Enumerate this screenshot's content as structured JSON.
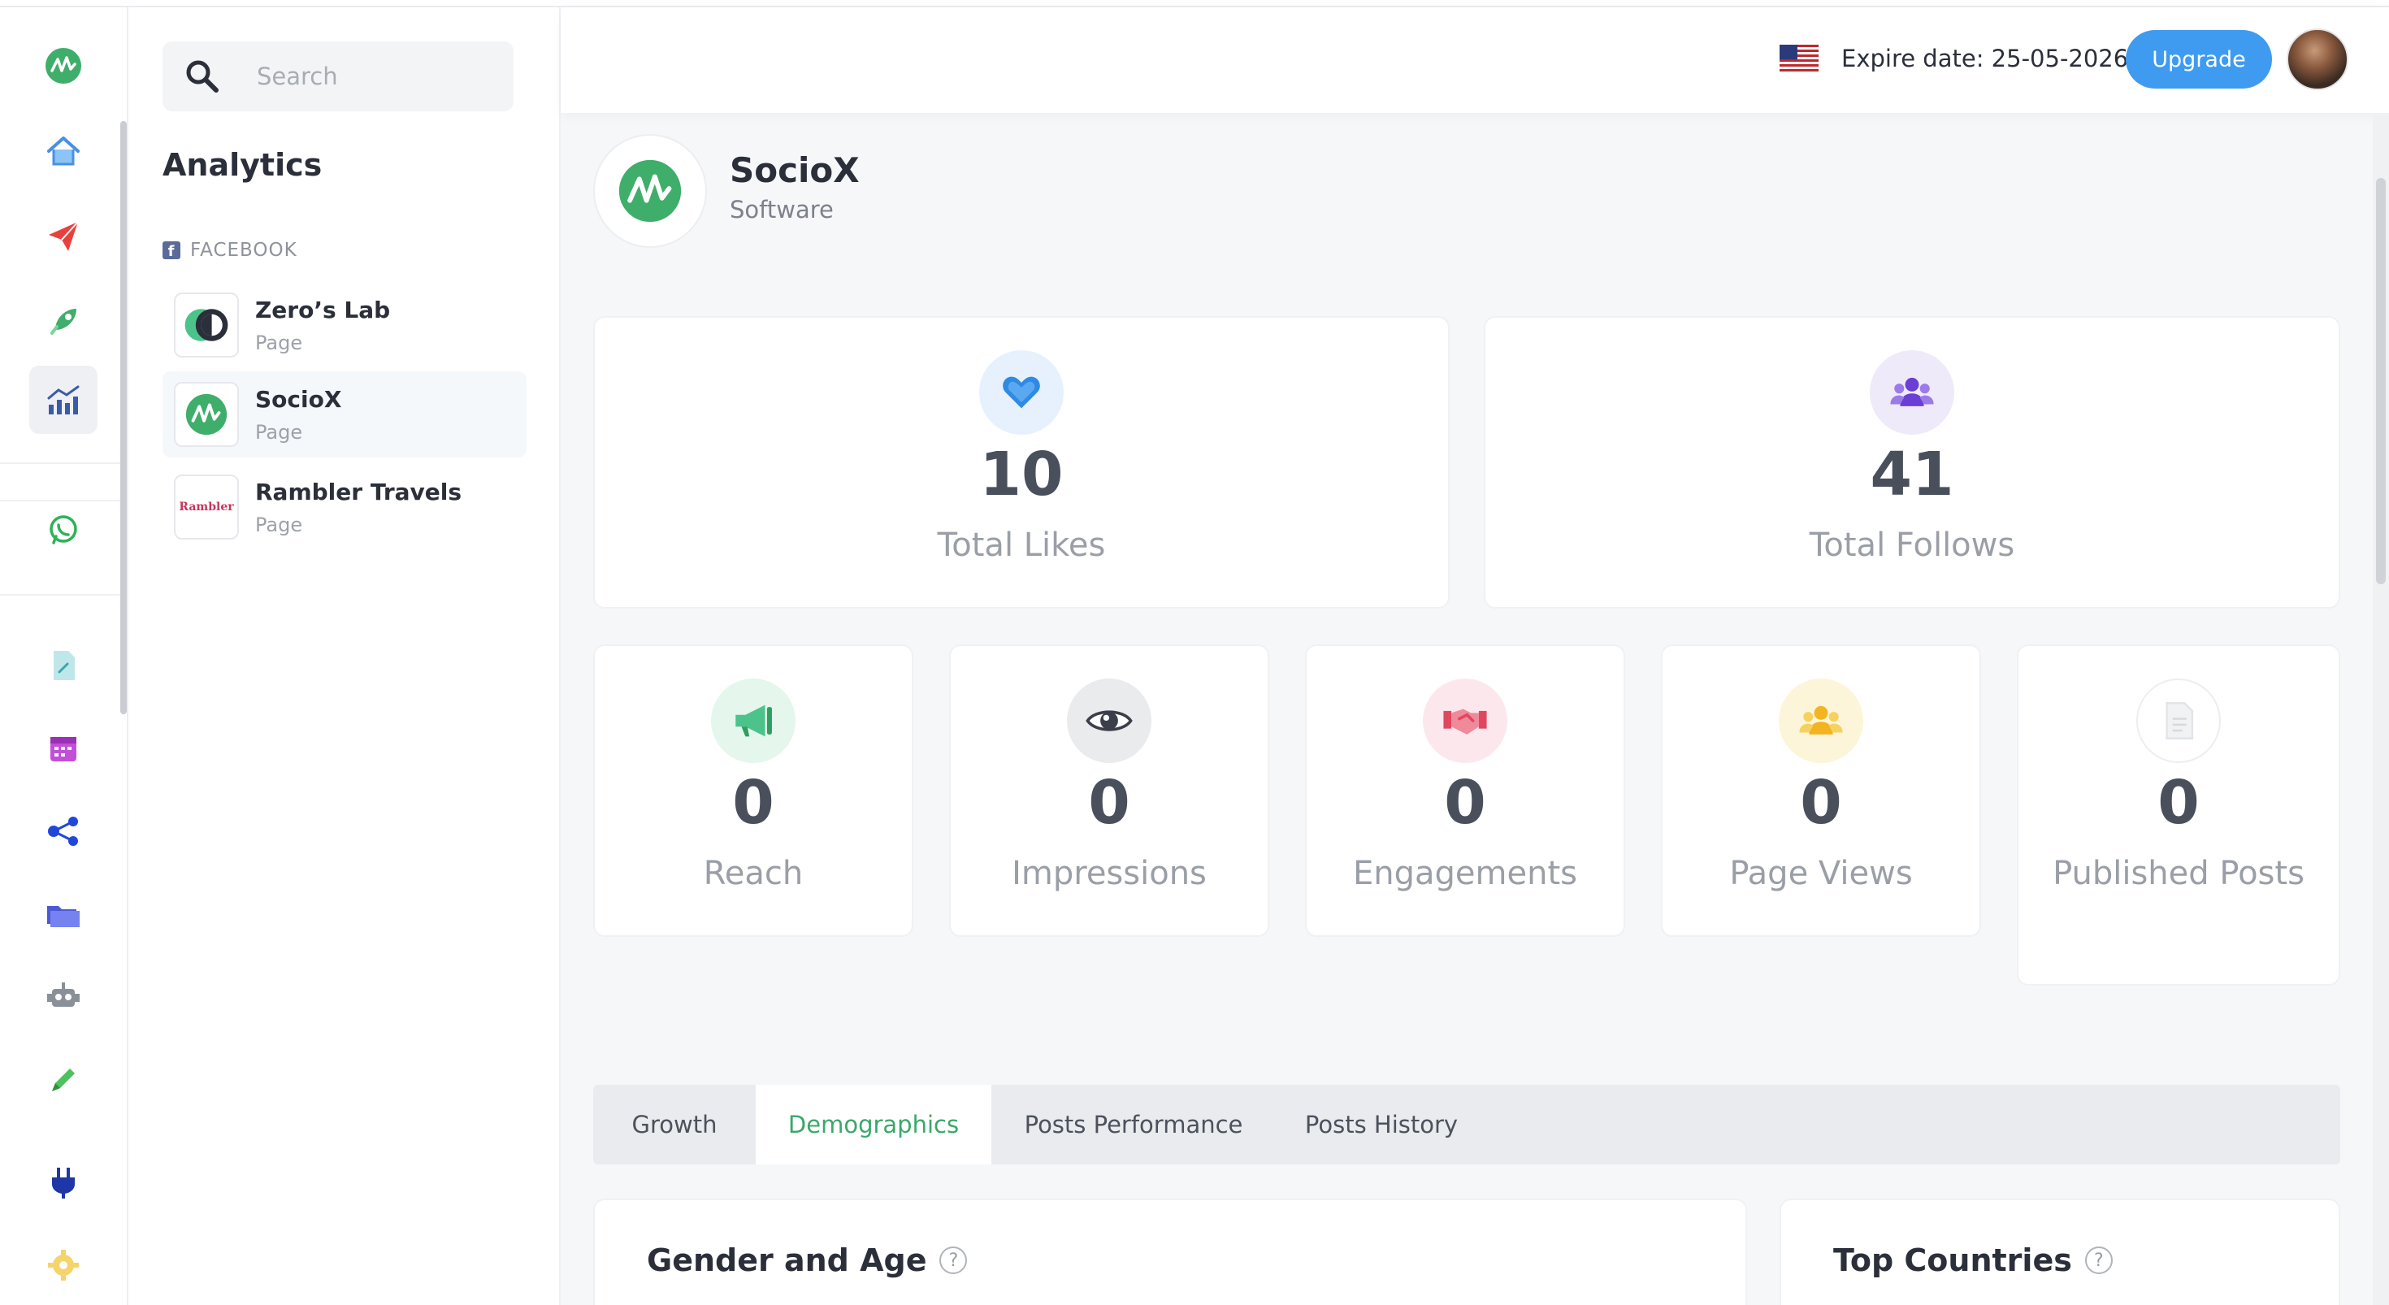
{
  "rail": {
    "icons": [
      "app-logo-icon",
      "home-icon",
      "send-icon",
      "rocket-icon",
      "analytics-icon",
      "whatsapp-icon",
      "file-icon",
      "calendar-icon",
      "share-icon",
      "folder-icon",
      "robot-icon",
      "pencil-icon",
      "plug-icon",
      "gear-icon"
    ]
  },
  "panel": {
    "search_placeholder": "Search",
    "title": "Analytics",
    "section": "FACEBOOK",
    "accounts": [
      {
        "name": "Zero’s Lab",
        "type": "Page"
      },
      {
        "name": "SocioX",
        "type": "Page"
      },
      {
        "name": "Rambler Travels",
        "type": "Page"
      }
    ],
    "rambler_logo_text": "Rambler"
  },
  "header": {
    "expire": "Expire date: 25-05-2026",
    "upgrade": "Upgrade"
  },
  "brand": {
    "name": "SocioX",
    "category": "Software"
  },
  "stats_top": [
    {
      "value": "10",
      "label": "Total Likes"
    },
    {
      "value": "41",
      "label": "Total Follows"
    }
  ],
  "stats": [
    {
      "value": "0",
      "label": "Reach"
    },
    {
      "value": "0",
      "label": "Impressions"
    },
    {
      "value": "0",
      "label": "Engagements"
    },
    {
      "value": "0",
      "label": "Page Views"
    },
    {
      "value": "0",
      "label": "Published Posts"
    }
  ],
  "tabs": [
    "Growth",
    "Demographics",
    "Posts Performance",
    "Posts History"
  ],
  "sections": [
    {
      "title": "Gender and Age"
    },
    {
      "title": "Top Countries"
    }
  ],
  "colors": {
    "accent_green": "#3aa86a",
    "upgrade_blue": "#3e9bf0"
  }
}
